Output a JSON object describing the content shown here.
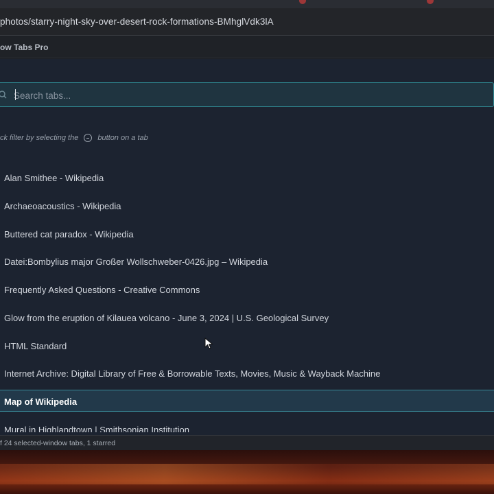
{
  "browser": {
    "url": "photos/starry-night-sky-over-desert-rock-formations-BMhglVdk3lA"
  },
  "extension": {
    "title": "ow Tabs Pro"
  },
  "search": {
    "placeholder": "Search tabs..."
  },
  "hint": {
    "before": "ck filter by selecting the",
    "after": "button on a tab"
  },
  "tabs": [
    {
      "title": "Alan Smithee - Wikipedia"
    },
    {
      "title": "Archaeoacoustics - Wikipedia"
    },
    {
      "title": "Buttered cat paradox - Wikipedia"
    },
    {
      "title": "Datei:Bombylius major Großer Wollschweber-0426.jpg – Wikipedia"
    },
    {
      "title": "Frequently Asked Questions - Creative Commons"
    },
    {
      "title": "Glow from the eruption of Kilauea volcano - June 3, 2024 | U.S. Geological Survey"
    },
    {
      "title": "HTML Standard"
    },
    {
      "title": "Internet Archive: Digital Library of Free & Borrowable Texts, Movies, Music & Wayback Machine"
    },
    {
      "title": "Map of Wikipedia",
      "active": true
    },
    {
      "title": "Mural in Highlandtown | Smithsonian Institution"
    }
  ],
  "status": {
    "text": "f 24 selected-window tabs, 1 starred"
  },
  "colors": {
    "accent": "#2f8a93",
    "panel_bg": "#1c2330",
    "active_row_bg": "#22394a"
  },
  "icons": [
    "search-icon",
    "filter-icon",
    "mouse-cursor-icon"
  ]
}
